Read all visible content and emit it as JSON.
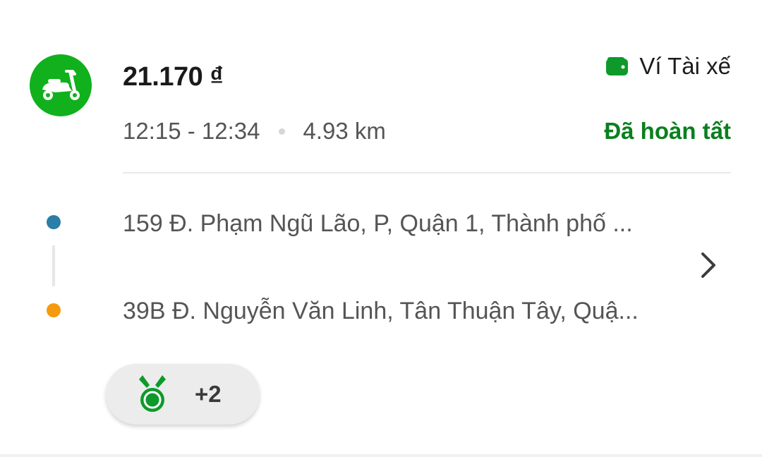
{
  "trip": {
    "service_icon": "bike-scooter-icon",
    "fare": "21.170 ₫",
    "payment_method": "Ví Tài xế",
    "payment_icon": "wallet-icon",
    "time_range": "12:15 - 12:34",
    "distance": "4.93 km",
    "status": "Đã hoàn tất",
    "pickup_address": "159 Đ. Phạm Ngũ Lão, P, Quận 1, Thành phố ...",
    "dropoff_address": "39B Đ. Nguyễn Văn Linh, Tân Thuận Tây, Quậ...",
    "badges": {
      "icon": "medal-icon",
      "count_label": "+2"
    }
  },
  "colors": {
    "brand_green": "#10b11c",
    "status_green": "#0a7f1f",
    "pickup_pin": "#2b7ea6",
    "dropoff_pin": "#f59a0f"
  }
}
